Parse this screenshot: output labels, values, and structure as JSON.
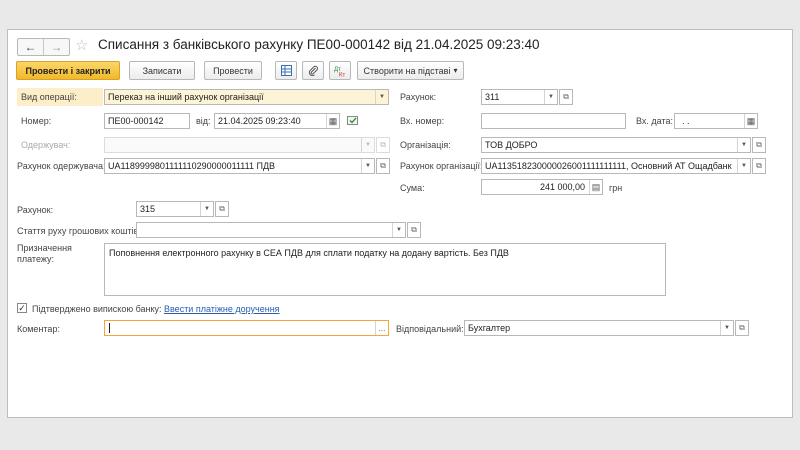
{
  "header": {
    "back": "←",
    "forward": "→",
    "star": "☆",
    "title": "Списання з банківського рахунку ПЕ00-000142 від 21.04.2025 09:23:40"
  },
  "toolbar": {
    "post_close": "Провести і закрити",
    "save": "Записати",
    "post": "Провести",
    "create_basis": "Створити на підставі",
    "create_basis_arrow": "▾",
    "icons": [
      "table-icon",
      "paperclip-icon",
      "dt-kt-icon"
    ]
  },
  "form": {
    "operation_label": "Вид операції:",
    "operation_value": "Переказ на інший рахунок організації",
    "account_label": "Рахунок:",
    "account_value": "311",
    "number_label": "Номер:",
    "number_value": "ПЕ00-000142",
    "date_label": "від:",
    "date_value": "21.04.2025 09:23:40",
    "in_number_label": "Вх. номер:",
    "in_number_value": "",
    "in_date_label": "Вх. дата:",
    "in_date_value": ". .",
    "recipient_label": "Одержувач:",
    "recipient_value": "",
    "org_label": "Організація:",
    "org_value": "ТОВ ДОБРО",
    "recipient_account_label": "Рахунок одержувача:",
    "recipient_account_value": "UA1189999801111110290000011111 ПДВ",
    "org_account_label": "Рахунок організації:",
    "org_account_value": "UA113518230000026001111111111, Основний АТ Ощадбанк",
    "sum_label": "Сума:",
    "sum_value": "241 000,00",
    "currency": "грн",
    "account2_label": "Рахунок:",
    "account2_value": "315",
    "cashflow_label": "Стаття руху грошових коштів:",
    "cashflow_value": "",
    "purpose_label": "Призначення платежу:",
    "purpose_value": "Поповнення електронного рахунку в СЕА ПДВ для сплати податку на додану вартість. Без ПДВ",
    "confirmed_label": "Підтверджено випискою банку:",
    "confirmed_checked": "✓",
    "enter_payment_link": "Ввести платіжне доручення",
    "comment_label": "Коментар:",
    "comment_value": "",
    "comment_btn": "...",
    "responsible_label": "Відповідальний:",
    "responsible_value": "Бухгалтер"
  },
  "glyphs": {
    "dropdown": "▼",
    "open": "⧉",
    "calendar": "▦",
    "calc": "▤"
  }
}
